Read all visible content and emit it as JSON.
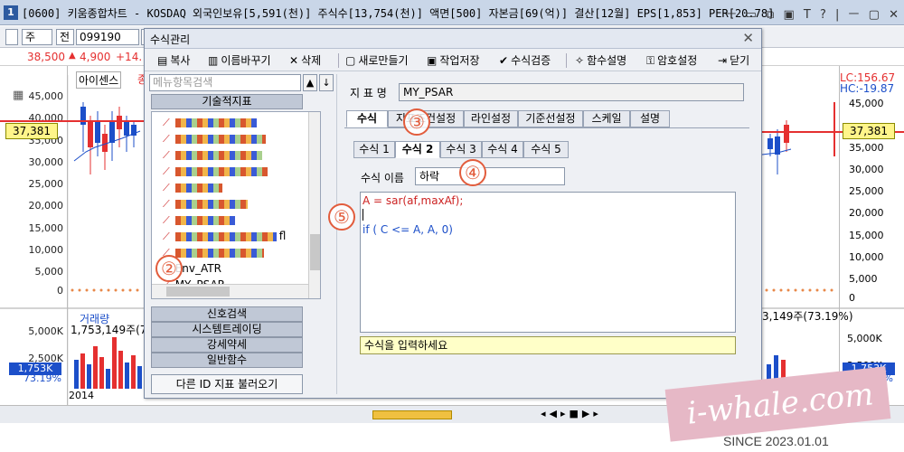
{
  "app": {
    "number": "1",
    "title": "[0600] 키움종합차트 - KOSDAQ 외국인보유[5,591(천)] 주식수[13,754(천)] 액면[500] 자본금[69(억)] 결산[12월] EPS[1,853] PER[20.78] 시가총"
  },
  "window_controls": [
    "ㅡ",
    "▭",
    "⧉",
    "▣",
    "T",
    "?",
    "|",
    "ㅡ",
    "▢",
    "✕"
  ],
  "toolbar": {
    "period": "주",
    "jeon": "전",
    "code": "099190",
    "extra": "C"
  },
  "pricebar": {
    "price": "38,500",
    "arrow": "▲",
    "change": "4,900",
    "pct": "+14."
  },
  "chart": {
    "lc": "LC:156.67",
    "hc": "HC:-19.87",
    "left_label": "아이센스",
    "left_label_2": "종",
    "price_ticks": [
      "45,000",
      "40,000",
      "35,000",
      "30,000",
      "25,000",
      "20,000",
      "15,000",
      "10,000",
      "5,000",
      "0"
    ],
    "current_price": "37,381",
    "volume_title": "거래량",
    "volume_left": "1,753,149주(73.19%)",
    "volume_right": "3,149주(73.19%)",
    "volume_ticks": [
      "5,000K",
      "2,500K"
    ],
    "volume_box": "1,753K",
    "volume_pct": "73.19%",
    "year": "2014"
  },
  "dialog": {
    "title": "수식관리",
    "close": "✕",
    "toolbar": [
      {
        "icon": "copy-icon",
        "glyph": "▤",
        "label": "복사"
      },
      {
        "icon": "rename-icon",
        "glyph": "▥",
        "label": "이름바꾸기"
      },
      {
        "icon": "delete-icon",
        "glyph": "✕",
        "label": "삭제"
      },
      {
        "icon": "new-file-icon",
        "glyph": "▢",
        "label": "새로만들기"
      },
      {
        "icon": "save-icon",
        "glyph": "▣",
        "label": "작업저장"
      },
      {
        "icon": "check-icon",
        "glyph": "✔",
        "label": "수식검증"
      },
      {
        "icon": "function-help-icon",
        "glyph": "✧",
        "label": "함수설명"
      },
      {
        "icon": "key-icon",
        "glyph": "⚿",
        "label": "암호설정"
      },
      {
        "icon": "exit-icon",
        "glyph": "⇥",
        "label": "닫기"
      }
    ],
    "search_placeholder": "메뉴항목검색",
    "search_btn": "▲",
    "down_btn": "↓",
    "category_top": "기술적지표",
    "tree_items": [
      {
        "label": "",
        "blot": 90
      },
      {
        "label": "",
        "blot": 100
      },
      {
        "label": "",
        "blot": 96
      },
      {
        "label": "",
        "blot": 102
      },
      {
        "label": "",
        "blot": 52
      },
      {
        "label": "",
        "blot": 80
      },
      {
        "label": "",
        "blot": 66
      },
      {
        "label": "fl",
        "blot": 112
      },
      {
        "label": "",
        "blot": 98
      },
      {
        "label": "Env_ATR",
        "blot": 0
      },
      {
        "label": "MY_PSAR",
        "blot": 0
      }
    ],
    "categories_bottom": [
      "신호검색",
      "시스템트레이딩",
      "강세약세",
      "일반함수"
    ],
    "load_other": "다른 ID 지표 불러오기",
    "indicator_label": "지 표 명",
    "indicator_name": "MY_PSAR",
    "tabs": [
      "수식",
      "지표조건설정",
      "라인설정",
      "기준선설정",
      "스케일",
      "설명"
    ],
    "subtabs": [
      "수식 1",
      "수식 2",
      "수식 3",
      "수식 4",
      "수식 5"
    ],
    "formula_name_label": "수식 이름",
    "formula_name": "하락",
    "code_lines": [
      "A = sar(af,maxAf);",
      "",
      "if ( C <= A, A, 0)"
    ],
    "hint": "수식을 입력하세요"
  },
  "markers": [
    "②",
    "③",
    "④",
    "⑤"
  ],
  "watermark": {
    "text": "i-whale.com",
    "since": "SINCE 2023.01.01"
  },
  "colors": {
    "accent": "#e53030",
    "highlight": "#fff58a",
    "blue": "#1c4fc9",
    "marker": "#e25c3c"
  }
}
